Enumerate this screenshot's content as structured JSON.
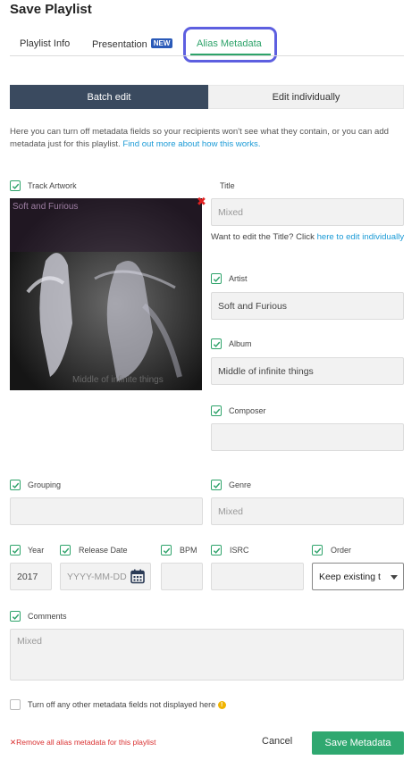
{
  "dialog": {
    "title": "Save Playlist"
  },
  "tabs": [
    {
      "label": "Playlist Info"
    },
    {
      "label": "Presentation",
      "badge": "NEW"
    },
    {
      "label": "Alias Metadata"
    }
  ],
  "mode": {
    "batch_label": "Batch edit",
    "individual_label": "Edit individually"
  },
  "description": {
    "text": "Here you can turn off metadata fields so your recipients won't see what they contain, or you can add metadata just for this playlist.",
    "link": "Find out more about how this works."
  },
  "track_artwork": {
    "label": "Track Artwork",
    "art_text_top": "Soft and Furious",
    "art_text_bottom": "Middle of infinite things"
  },
  "title_field": {
    "label": "Title",
    "value": "Mixed",
    "hint": "Want to edit the Title? Click",
    "hint_link": "here to edit individually"
  },
  "artist": {
    "label": "Artist",
    "value": "Soft and Furious"
  },
  "album": {
    "label": "Album",
    "value": "Middle of infinite things"
  },
  "composer": {
    "label": "Composer",
    "value": ""
  },
  "grouping": {
    "label": "Grouping",
    "value": ""
  },
  "genre": {
    "label": "Genre",
    "value": "Mixed"
  },
  "year": {
    "label": "Year",
    "value": "2017"
  },
  "release_date": {
    "label": "Release Date",
    "placeholder": "YYYY-MM-DD"
  },
  "bpm": {
    "label": "BPM",
    "value": ""
  },
  "isrc": {
    "label": "ISRC",
    "value": ""
  },
  "order": {
    "label": "Order",
    "selected": "Keep existing t"
  },
  "comments": {
    "label": "Comments",
    "value": "Mixed"
  },
  "turn_off_others": {
    "label": "Turn off any other metadata fields not displayed here"
  },
  "footer": {
    "remove_label": "Remove all alias metadata for this playlist",
    "cancel_label": "Cancel",
    "save_label": "Save Metadata"
  },
  "colors": {
    "accent_green": "#2fa870",
    "active_tab_ring": "#5d5fe0",
    "segment_dark": "#3a4a5f",
    "link_blue": "#1a9ad6",
    "remove_red": "#d93030"
  }
}
